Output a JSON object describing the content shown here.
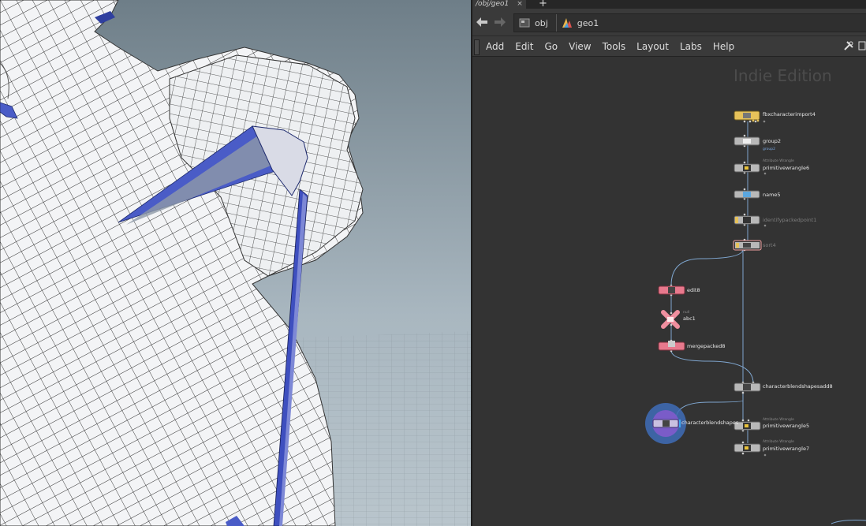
{
  "network": {
    "tab": {
      "label": "/obj/geo1",
      "close": "×"
    },
    "new_tab": "+",
    "path": {
      "back": "back-arrow",
      "forward": "forward-arrow",
      "crumbs": [
        {
          "label": "obj",
          "icon": "obj-network-icon"
        },
        {
          "label": "geo1",
          "icon": "geo-node-icon"
        }
      ]
    },
    "menu": [
      "Add",
      "Edit",
      "Go",
      "View",
      "Tools",
      "Layout",
      "Labs",
      "Help"
    ],
    "watermark": "Indie Edition",
    "nodes": {
      "fbx": {
        "label": "fbxcharacterimport4"
      },
      "group": {
        "label": "group2",
        "sub": "group2"
      },
      "pw6": {
        "label": "primitivewrangle6",
        "sub": "Attribute Wrangle"
      },
      "name": {
        "label": "name5"
      },
      "ident": {
        "label": "identifypackedpoint1"
      },
      "sort": {
        "label": "sort4"
      },
      "edit": {
        "label": "edit8"
      },
      "abc": {
        "label": "abc1",
        "sub": "null"
      },
      "merge": {
        "label": "mergepacked8"
      },
      "cbsadd": {
        "label": "characterblendshapesadd8"
      },
      "cbs": {
        "label": "characterblendshapes"
      },
      "pw5": {
        "label": "primitivewrangle5",
        "sub": "Attribute Wrangle"
      },
      "pw7": {
        "label": "primitivewrangle7",
        "sub": "Attribute Wrangle"
      }
    },
    "colors": {
      "yellow": "#e7c25a",
      "grey": "#b8b8b8",
      "pink": "#e8798d",
      "pink_node": "#ef8f9f",
      "purple": "#5a3f9a",
      "wire": "#7fa6cf"
    }
  }
}
